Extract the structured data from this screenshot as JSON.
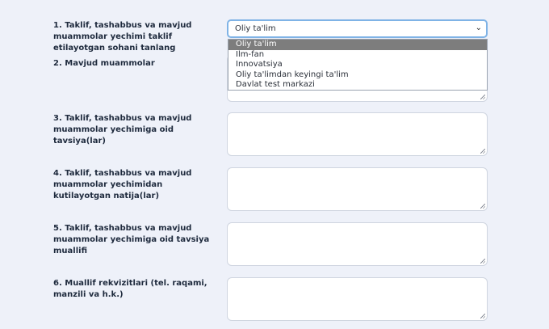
{
  "fields": [
    {
      "label": "1. Taklif, tashabbus va mavjud muammolar yechimi taklif etilayotgan sohani tanlang"
    },
    {
      "label": "2. Mavjud muammolar"
    },
    {
      "label": "3. Taklif, tashabbus va mavjud muammolar yechimiga oid tavsiya(lar)"
    },
    {
      "label": "4. Taklif, tashabbus va mavjud muammolar yechimidan kutilayotgan natija(lar)"
    },
    {
      "label": "5. Taklif, tashabbus va mavjud muammolar yechimiga oid tavsiya muallifi"
    },
    {
      "label": "6. Muallif rekvizitlari (tel. raqami, manzili va h.k.)"
    }
  ],
  "select": {
    "value": "Oliy ta'lim",
    "options": [
      "Oliy ta'lim",
      "Ilm-fan",
      "Innovatsiya",
      "Oliy ta'limdan keyingi ta'lim",
      "Davlat test markazi"
    ],
    "selected_index": 0
  },
  "icons": {
    "select_chevron": "chevron-down-icon",
    "resize": "resize-grip-icon"
  }
}
